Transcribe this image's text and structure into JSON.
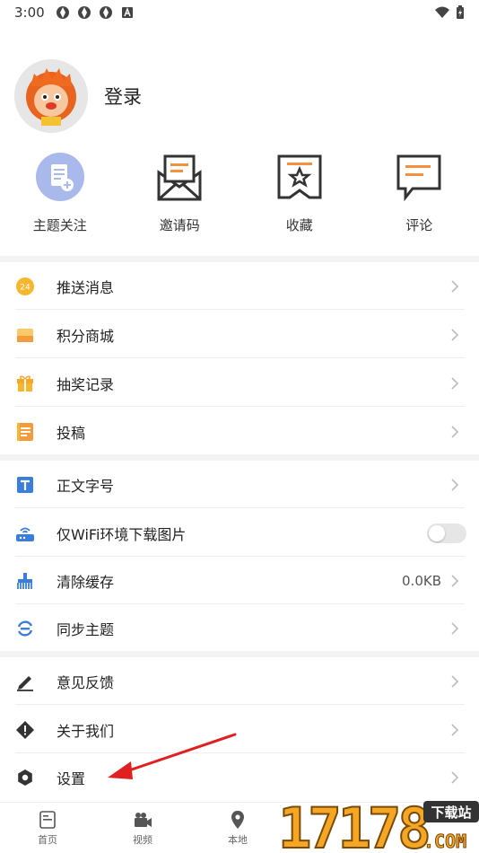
{
  "status_bar": {
    "time": "3:00"
  },
  "profile": {
    "login_label": "登录"
  },
  "quick_actions": [
    {
      "label": "主题关注",
      "icon": "topic-follow-icon"
    },
    {
      "label": "邀请码",
      "icon": "invite-envelope-icon"
    },
    {
      "label": "收藏",
      "icon": "bookmark-star-icon"
    },
    {
      "label": "评论",
      "icon": "comment-bubble-icon"
    }
  ],
  "menu_group1": [
    {
      "label": "推送消息",
      "icon": "push-badge-icon"
    },
    {
      "label": "积分商城",
      "icon": "points-mall-icon"
    },
    {
      "label": "抽奖记录",
      "icon": "gift-icon"
    },
    {
      "label": "投稿",
      "icon": "contribute-note-icon"
    }
  ],
  "menu_group2": [
    {
      "label": "正文字号",
      "icon": "font-size-icon"
    },
    {
      "label": "仅WiFi环境下载图片",
      "icon": "wifi-router-icon",
      "toggle": false
    },
    {
      "label": "清除缓存",
      "icon": "broom-icon",
      "value": "0.0KB"
    },
    {
      "label": "同步主题",
      "icon": "sync-icon"
    }
  ],
  "menu_group3": [
    {
      "label": "意见反馈",
      "icon": "pencil-icon"
    },
    {
      "label": "关于我们",
      "icon": "info-diamond-icon"
    },
    {
      "label": "设置",
      "icon": "gear-icon"
    }
  ],
  "tabbar": [
    {
      "label": "首页",
      "icon": "home-news-icon"
    },
    {
      "label": "视频",
      "icon": "video-camera-icon"
    },
    {
      "label": "本地",
      "icon": "location-pin-icon"
    }
  ],
  "watermark": {
    "digits": "17178",
    "tag": "下载站",
    "suffix": ".COM"
  },
  "colors": {
    "accent_orange": "#f39c3d",
    "accent_blue": "#3b7ddd",
    "arrow_red": "#e02020"
  }
}
